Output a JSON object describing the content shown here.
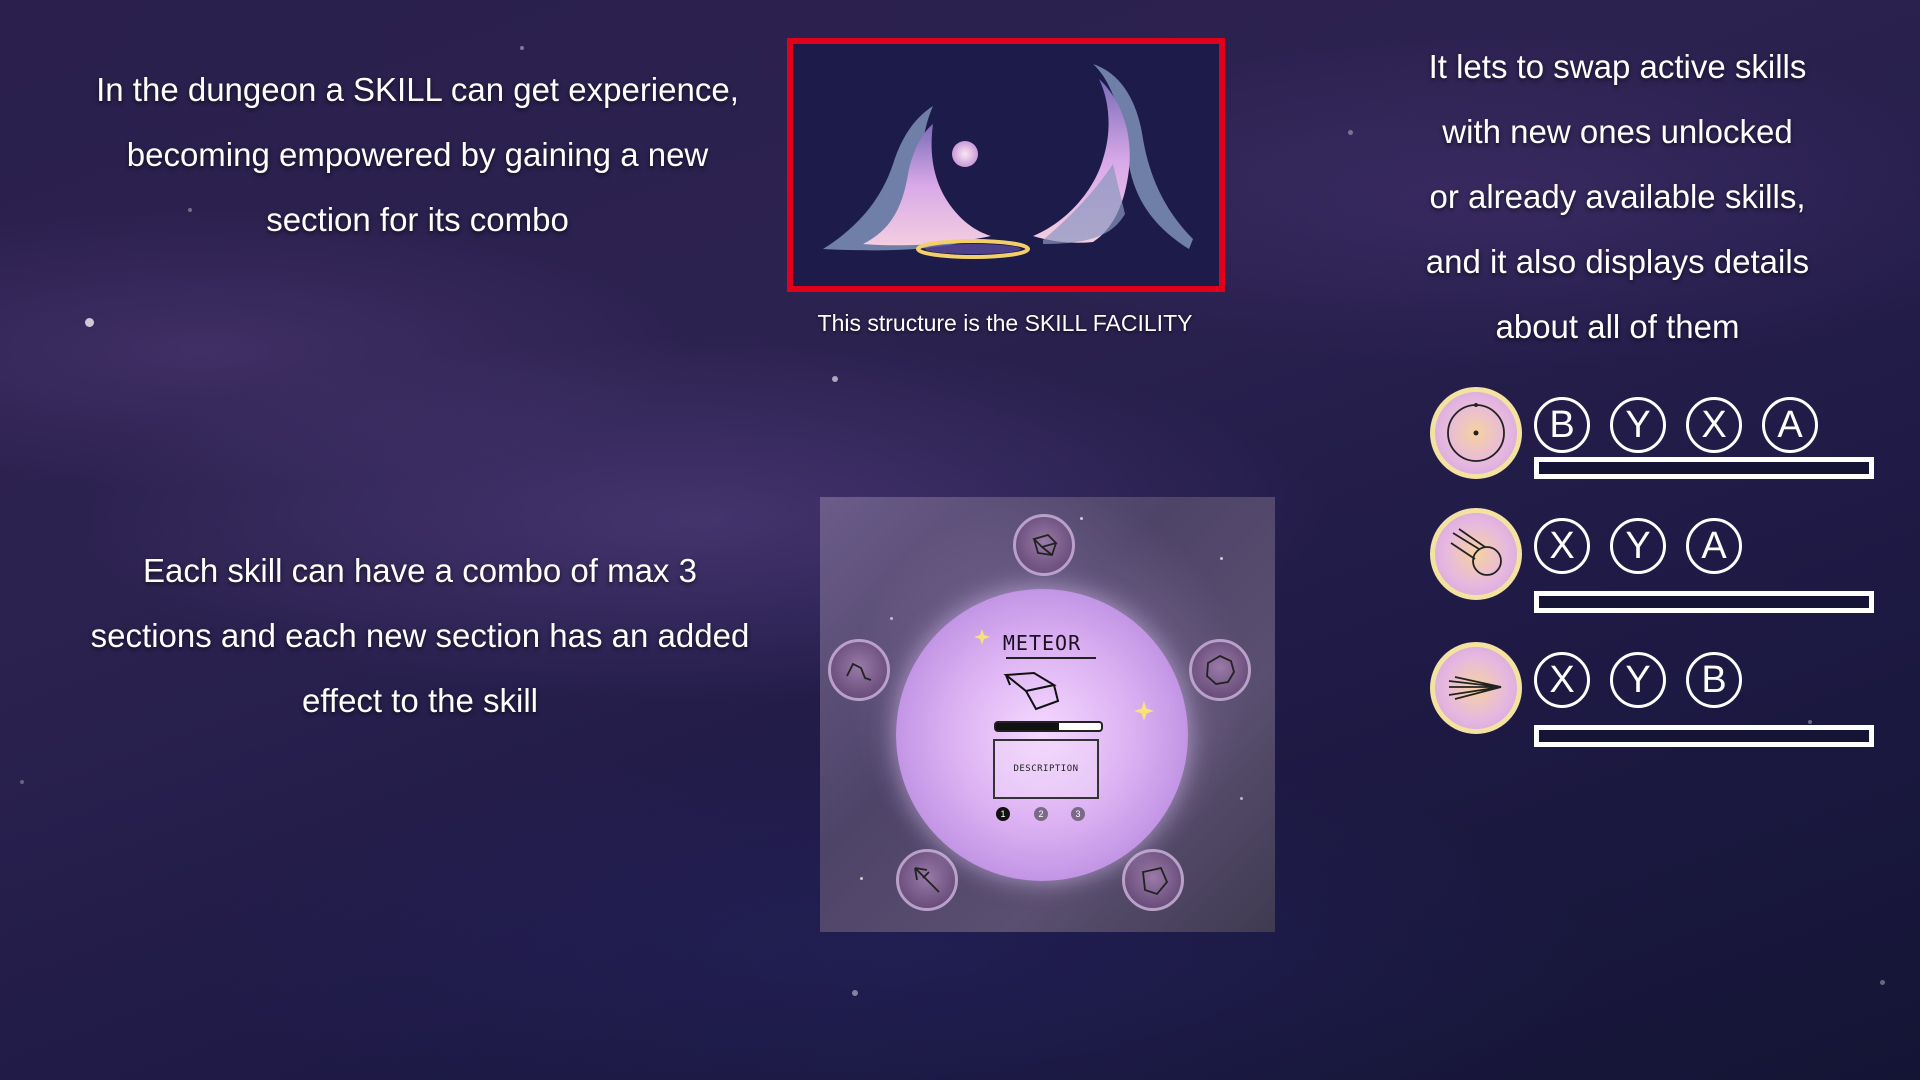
{
  "intro_text": {
    "lines": [
      "In the dungeon a SKILL can get experience,",
      "becoming empowered by gaining a new",
      "section for its combo"
    ]
  },
  "facility": {
    "caption": "This structure is the SKILL FACILITY"
  },
  "swap_text": {
    "lines": [
      "It lets to swap active skills",
      "with new ones unlocked",
      "or already available skills,",
      "and it also displays details",
      "about all of them"
    ]
  },
  "combo_text": {
    "lines": [
      "Each skill can have a combo of max 3",
      "sections and each new section has an added",
      "effect to the skill"
    ]
  },
  "skill_panel": {
    "title": "METEOR",
    "description_label": "DESCRIPTION",
    "xp_progress": 0.6,
    "pages": [
      "1",
      "2",
      "3"
    ],
    "orbs": [
      "cube-constellation-icon",
      "zigzag-constellation-icon",
      "ring-constellation-icon",
      "arrow-constellation-icon",
      "pentagon-constellation-icon"
    ]
  },
  "skills": [
    {
      "icon": "sun-orbit-icon",
      "buttons": [
        "B",
        "Y",
        "X",
        "A"
      ],
      "xp_progress": 0
    },
    {
      "icon": "meteor-icon",
      "buttons": [
        "X",
        "Y",
        "A"
      ],
      "xp_progress": 0
    },
    {
      "icon": "beam-icon",
      "buttons": [
        "X",
        "Y",
        "B"
      ],
      "xp_progress": 0
    }
  ],
  "colors": {
    "highlight_border": "#e0001a",
    "skill_icon_ring": "#f3e2a0"
  }
}
